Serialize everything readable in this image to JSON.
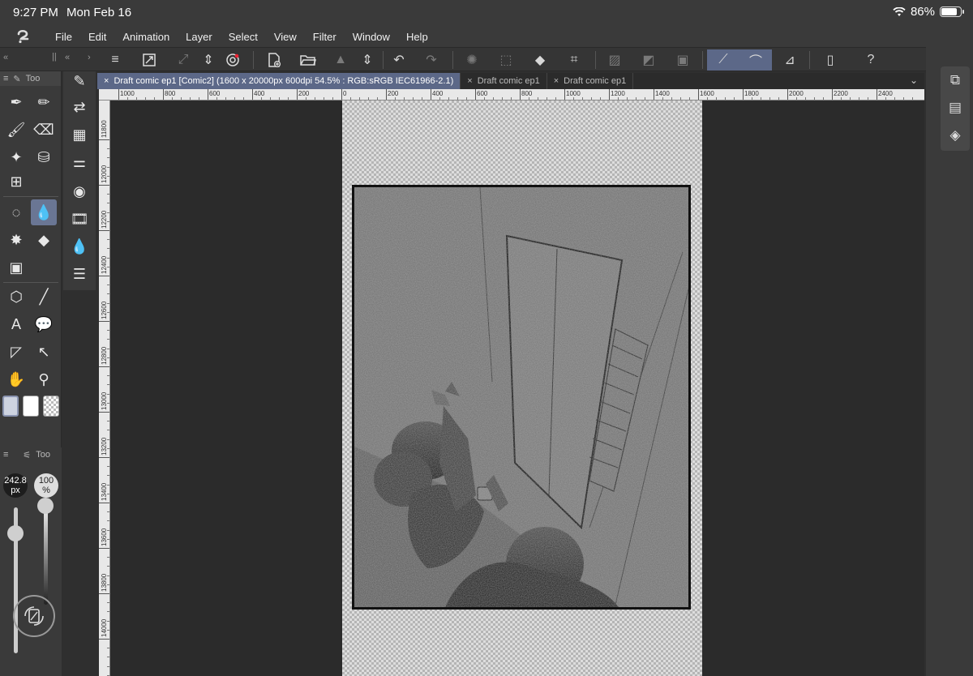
{
  "status": {
    "time": "9:27 PM",
    "date": "Mon Feb 16",
    "battery": "86%",
    "battery_level": 0.86
  },
  "menu": [
    "File",
    "Edit",
    "Animation",
    "Layer",
    "Select",
    "View",
    "Filter",
    "Window",
    "Help"
  ],
  "tabs": [
    {
      "label": "Draft comic ep1  [Comic2] (1600 x 20000px 600dpi 54.5% : RGB:sRGB IEC61966-2.1)",
      "active": true
    },
    {
      "label": "Draft comic ep1",
      "active": false
    },
    {
      "label": "Draft comic ep1",
      "active": false
    }
  ],
  "tool_panel": {
    "title": "Too"
  },
  "tool_property_panel": {
    "title": "Too"
  },
  "brush": {
    "size_value": "242.8",
    "size_unit": "px",
    "opacity_value": "100",
    "opacity_unit": "%"
  },
  "ruler_top_labels": [
    "1000",
    "800",
    "600",
    "400",
    "200",
    "0",
    "200",
    "400",
    "600",
    "800",
    "1000",
    "1200",
    "1400",
    "1600",
    "1800",
    "2000",
    "2200",
    "2400"
  ],
  "ruler_left_labels": [
    "11800",
    "12000",
    "12200",
    "12400",
    "12600",
    "12800",
    "13000",
    "13200",
    "13400",
    "13600",
    "13800",
    "14000"
  ],
  "colors": {
    "accent": "#5c6888",
    "panel": "#3a3a3a",
    "canvas_bg": "#2b2b2b"
  },
  "icons": {
    "menu": "hamburger-icon",
    "undo": "undo-icon",
    "redo": "redo-icon"
  }
}
